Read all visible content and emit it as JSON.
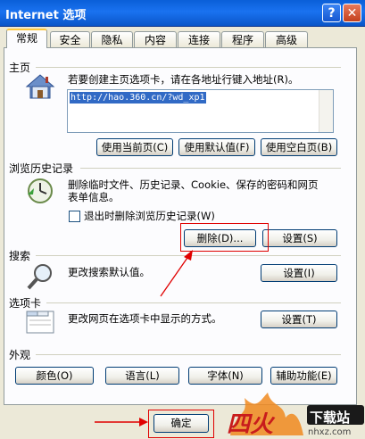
{
  "window": {
    "title": "Internet 选项",
    "help_label": "?",
    "close_label": "✕"
  },
  "tabs": [
    {
      "label": "常规"
    },
    {
      "label": "安全"
    },
    {
      "label": "隐私"
    },
    {
      "label": "内容"
    },
    {
      "label": "连接"
    },
    {
      "label": "程序"
    },
    {
      "label": "高级"
    }
  ],
  "home": {
    "title": "主页",
    "desc": "若要创建主页选项卡，请在各地址行键入地址(R)。",
    "url": "http://hao.360.cn/?wd_xp1",
    "btn_current": "使用当前页(C)",
    "btn_default": "使用默认值(F)",
    "btn_blank": "使用空白页(B)"
  },
  "history": {
    "title": "浏览历史记录",
    "desc1": "删除临时文件、历史记录、Cookie、保存的密码和网页",
    "desc2": "表单信息。",
    "checkbox_label": "退出时删除浏览历史记录(W)",
    "btn_delete": "删除(D)...",
    "btn_settings": "设置(S)"
  },
  "search": {
    "title": "搜索",
    "desc": "更改搜索默认值。",
    "btn_settings": "设置(I)"
  },
  "tabs_section": {
    "title": "选项卡",
    "desc": "更改网页在选项卡中显示的方式。",
    "btn_settings": "设置(T)"
  },
  "appearance": {
    "title": "外观",
    "btn_colors": "颜色(O)",
    "btn_languages": "语言(L)",
    "btn_fonts": "字体(N)",
    "btn_accessibility": "辅助功能(E)"
  },
  "footer": {
    "btn_ok": "确定",
    "logo_text": "下载站",
    "logo_url": "nhxz.com"
  },
  "colors": {
    "accent_red": "#e00000",
    "title_blue": "#0a5fd8"
  }
}
